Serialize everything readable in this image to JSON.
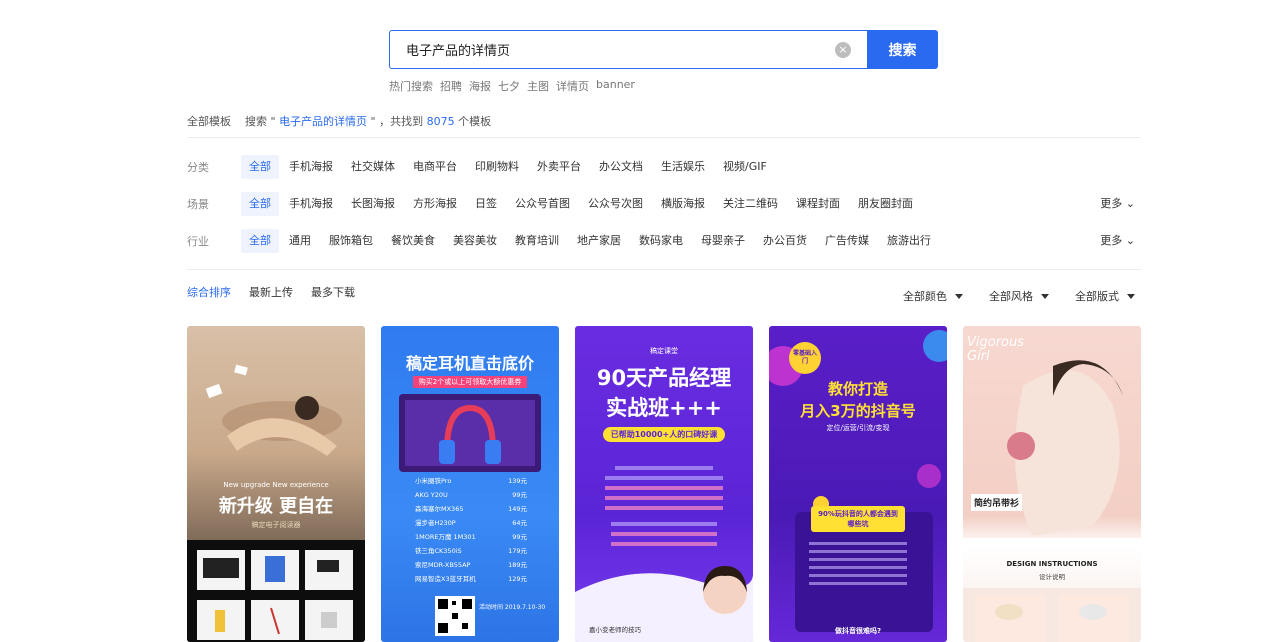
{
  "search": {
    "value": "电子产品的详情页",
    "button_label": "搜索",
    "clear_icon": "close-circle-icon",
    "hot": [
      "热门搜索",
      "招聘",
      "海报",
      "七夕",
      "主图",
      "详情页",
      "banner"
    ]
  },
  "result": {
    "prefix": "全部模板",
    "search_word": "搜索",
    "quote_open": " \" ",
    "keyword": "电子产品的详情页",
    "quote_close": " \" ，共找到 ",
    "count": "8075",
    "suffix": " 个模板"
  },
  "filters": [
    {
      "label": "分类",
      "items": [
        "全部",
        "手机海报",
        "社交媒体",
        "电商平台",
        "印刷物料",
        "外卖平台",
        "办公文档",
        "生活娱乐",
        "视频/GIF"
      ],
      "more": ""
    },
    {
      "label": "场景",
      "items": [
        "全部",
        "手机海报",
        "长图海报",
        "方形海报",
        "日签",
        "公众号首图",
        "公众号次图",
        "横版海报",
        "关注二维码",
        "课程封面",
        "朋友圈封面"
      ],
      "more": "更多"
    },
    {
      "label": "行业",
      "items": [
        "全部",
        "通用",
        "服饰箱包",
        "餐饮美食",
        "美容美妆",
        "教育培训",
        "地产家居",
        "数码家电",
        "母婴亲子",
        "办公百货",
        "广告传媒",
        "旅游出行"
      ],
      "more": "更多"
    }
  ],
  "sort": [
    "综合排序",
    "最新上传",
    "最多下载"
  ],
  "dropdowns": [
    "全部颜色",
    "全部风格",
    "全部版式"
  ],
  "cards": [
    {
      "title": "新升级 更自在",
      "subtitle": "New upgrade New experience",
      "tag": "稿定电子阅读器"
    },
    {
      "title": "稿定耳机直击底价",
      "subtitle": "购买2个或以上可领取大额优惠券",
      "list": [
        [
          "小米圈铁Pro",
          "139元"
        ],
        [
          "AKG Y20U",
          "99元"
        ],
        [
          "森海塞尔MX365",
          "149元"
        ],
        [
          "漫步者H230P",
          "64元"
        ],
        [
          "1MORE万魔 1M301",
          "99元"
        ],
        [
          "铁三角CK350iS",
          "179元"
        ],
        [
          "索尼MDR-XB55AP",
          "189元"
        ],
        [
          "网易智造X3蓝牙耳机",
          "129元"
        ]
      ],
      "footer": "活动时间 2019.7.10-30"
    },
    {
      "top": "稿定课堂",
      "title1": "90天产品经理",
      "title2": "实战班+++",
      "badge": "已帮助10000+人的口碑好课",
      "footer": "嘉小变老师的技巧"
    },
    {
      "badge": "零基础入门",
      "title1": "教你打造",
      "title2": "月入3万的抖音号",
      "sub": "定位/运营/引流/变现",
      "box": "90%玩抖音的人都会遇到哪些坑",
      "footer": "做抖音很难吗?"
    },
    {
      "title": "Vigorous Girl",
      "label": "简约吊带衫",
      "section": "DESIGN INSTRUCTIONS",
      "section_sub": "设计说明"
    }
  ],
  "colors": {
    "accent": "#2a6af0"
  }
}
